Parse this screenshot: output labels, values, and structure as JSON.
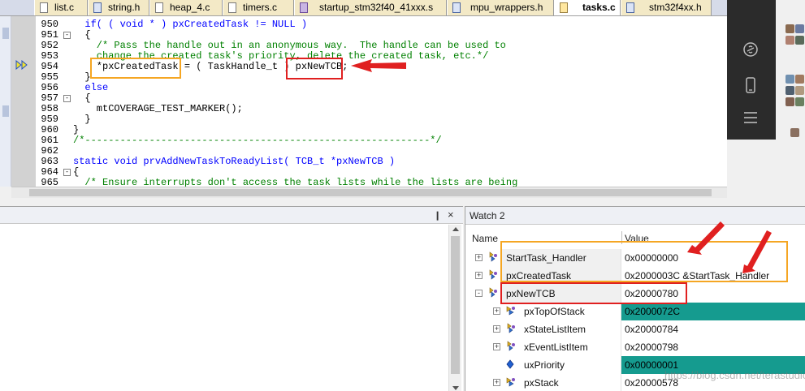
{
  "tabs": [
    {
      "label": "list.c",
      "icon": "file-c-icon"
    },
    {
      "label": "string.h",
      "icon": "file-h-icon"
    },
    {
      "label": "heap_4.c",
      "icon": "file-c-icon"
    },
    {
      "label": "timers.c",
      "icon": "file-c-icon"
    },
    {
      "label": "startup_stm32f40_41xxx.s",
      "icon": "file-asm-icon"
    },
    {
      "label": "mpu_wrappers.h",
      "icon": "file-h-icon"
    },
    {
      "label": "tasks.c",
      "icon": "file-c-icon",
      "active": true
    },
    {
      "label": "stm32f4xx.h",
      "icon": "file-h-icon"
    }
  ],
  "editor": {
    "lines": [
      {
        "num": "950",
        "fold": "",
        "text": "  if( ( void * ) pxCreatedTask != NULL )"
      },
      {
        "num": "951",
        "fold": "-",
        "text": "  {"
      },
      {
        "num": "952",
        "fold": "",
        "text": "    /* Pass the handle out in an anonymous way.  The handle can be used to"
      },
      {
        "num": "953",
        "fold": "",
        "text": "    change the created task's priority, delete the created task, etc.*/"
      },
      {
        "num": "954",
        "fold": "",
        "text": "    *pxCreatedTask = ( TaskHandle_t ) pxNewTCB;"
      },
      {
        "num": "955",
        "fold": "",
        "text": "  }"
      },
      {
        "num": "956",
        "fold": "",
        "text": "  else"
      },
      {
        "num": "957",
        "fold": "-",
        "text": "  {"
      },
      {
        "num": "958",
        "fold": "",
        "text": "    mtCOVERAGE_TEST_MARKER();"
      },
      {
        "num": "959",
        "fold": "",
        "text": "  }"
      },
      {
        "num": "960",
        "fold": "",
        "text": "}"
      },
      {
        "num": "961",
        "fold": "",
        "text": "/*-----------------------------------------------------------*/"
      },
      {
        "num": "962",
        "fold": "",
        "text": ""
      },
      {
        "num": "963",
        "fold": "",
        "text": "static void prvAddNewTaskToReadyList( TCB_t *pxNewTCB )"
      },
      {
        "num": "964",
        "fold": "-",
        "text": "{"
      },
      {
        "num": "965",
        "fold": "",
        "text": "  /* Ensure interrupts don't access the task lists while the lists are being"
      }
    ],
    "current_line": "954"
  },
  "watch": {
    "title": "Watch 2",
    "col_name": "Name",
    "col_value": "Value",
    "rows": [
      {
        "name": "StartTask_Handler",
        "value": "0x00000000",
        "level": 0,
        "expander": "+",
        "icon": "struct-var-icon",
        "highlight": false
      },
      {
        "name": "pxCreatedTask",
        "value": "0x2000003C &StartTask_Handler",
        "level": 0,
        "expander": "+",
        "icon": "struct-var-icon",
        "highlight": false
      },
      {
        "name": "pxNewTCB",
        "value": "0x20000780",
        "level": 0,
        "expander": "-",
        "icon": "struct-var-icon",
        "highlight": false
      },
      {
        "name": "pxTopOfStack",
        "value": "0x2000072C",
        "level": 1,
        "expander": "+",
        "icon": "pointer-var-icon",
        "highlight": true
      },
      {
        "name": "xStateListItem",
        "value": "0x20000784",
        "level": 1,
        "expander": "+",
        "icon": "struct-var-icon",
        "highlight": false
      },
      {
        "name": "xEventListItem",
        "value": "0x20000798",
        "level": 1,
        "expander": "+",
        "icon": "struct-var-icon",
        "highlight": false
      },
      {
        "name": "uxPriority",
        "value": "0x00000001",
        "level": 1,
        "expander": "",
        "icon": "diamond-var-icon",
        "highlight": true
      },
      {
        "name": "pxStack",
        "value": "0x20000578",
        "level": 1,
        "expander": "+",
        "icon": "pointer-var-icon",
        "highlight": false
      }
    ]
  },
  "left_pane": {
    "pin_glyph": "❙",
    "close_glyph": "×"
  },
  "watermark": "https://blog.csdn.net/terastudio",
  "colors": {
    "orange_box": "#f5a623",
    "red_box": "#e02020",
    "teal_highlight": "#159b8f",
    "tab_bg": "#f3e9c6"
  }
}
